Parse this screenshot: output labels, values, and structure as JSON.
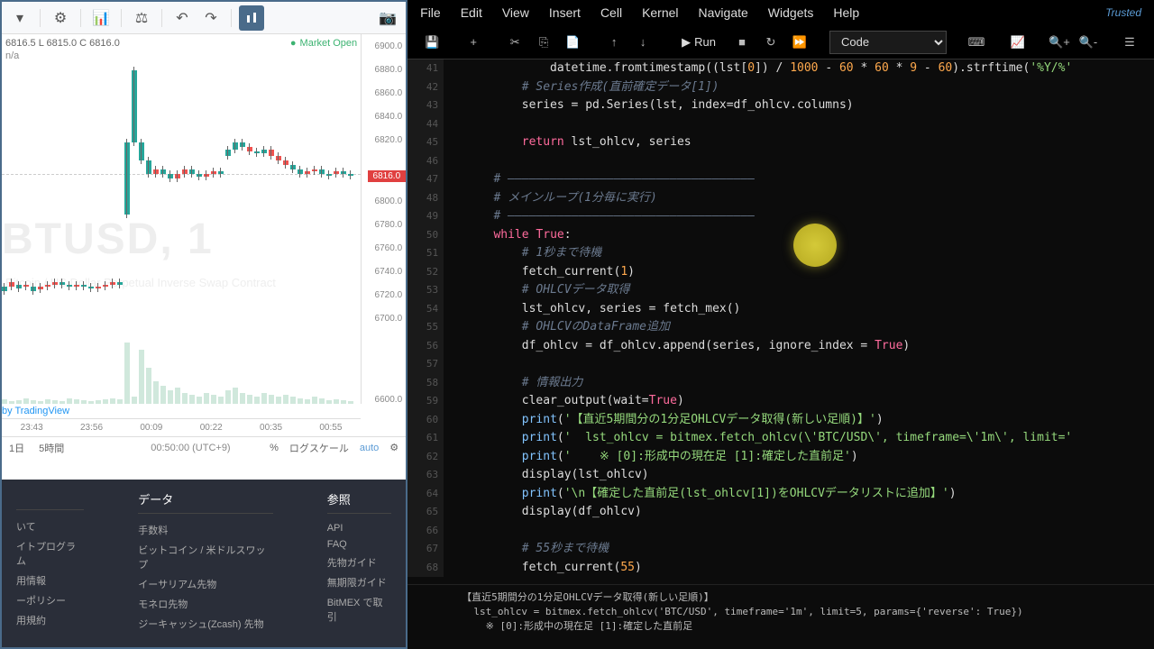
{
  "chart": {
    "ohlc": "6816.5 L 6815.0 C 6816.0",
    "na": "n/a",
    "market_status": "Market Open",
    "watermark": "BTUSD, 1",
    "watermark_sub": "Bitcoin / US Dollar Perpetual Inverse Swap Contract",
    "tv_link": "by TradingView",
    "price_current": "6816.0",
    "price_ticks": [
      "6900.0",
      "6880.0",
      "6860.0",
      "6840.0",
      "6820.0",
      "6800.0",
      "6780.0",
      "6760.0",
      "6740.0",
      "6720.0",
      "6700.0",
      "6600.0"
    ],
    "time_ticks": [
      "23:43",
      "23:56",
      "00:09",
      "00:22",
      "00:35",
      "00:55"
    ],
    "bottom": {
      "d1": "1日",
      "d5": "5時間",
      "time": "00:50:00 (UTC+9)",
      "pct": "%",
      "log": "ログスケール",
      "auto": "auto"
    }
  },
  "jupyter": {
    "menu": [
      "File",
      "Edit",
      "View",
      "Insert",
      "Cell",
      "Kernel",
      "Navigate",
      "Widgets",
      "Help"
    ],
    "trusted": "Trusted",
    "run": "Run",
    "cell_type": "Code",
    "line_start": 41,
    "code_lines": [
      {
        "n": 41,
        "html": "            datetime.fromtimestamp((lst[<span class='num'>0</span>]) / <span class='num'>1000</span> <span class='op'>-</span> <span class='num'>60</span> <span class='op'>*</span> <span class='num'>60</span> <span class='op'>*</span> <span class='num'>9</span> <span class='op'>-</span> <span class='num'>60</span>).strftime(<span class='str'>'%Y/%'</span>"
      },
      {
        "n": 42,
        "html": "        <span class='cm'># Series作成(直前確定データ[1])</span>"
      },
      {
        "n": 43,
        "html": "        series = pd.Series(lst, index=df_ohlcv.columns)"
      },
      {
        "n": 44,
        "html": ""
      },
      {
        "n": 45,
        "html": "        <span class='kw'>return</span> lst_ohlcv, series"
      },
      {
        "n": 46,
        "html": ""
      },
      {
        "n": 47,
        "html": "    <span class='cm'># ―――――――――――――――――――――――――――――――――――</span>"
      },
      {
        "n": 48,
        "html": "    <span class='cm'># メインループ(1分毎に実行)</span>"
      },
      {
        "n": 49,
        "html": "    <span class='cm'># ―――――――――――――――――――――――――――――――――――</span>"
      },
      {
        "n": 50,
        "html": "    <span class='kw'>while</span> <span class='bool'>True</span>:"
      },
      {
        "n": 51,
        "html": "        <span class='cm'># 1秒まで待機</span>"
      },
      {
        "n": 52,
        "html": "        fetch_current(<span class='num'>1</span>)"
      },
      {
        "n": 53,
        "html": "        <span class='cm'># OHLCVデータ取得</span>"
      },
      {
        "n": 54,
        "html": "        lst_ohlcv, series = fetch_mex()"
      },
      {
        "n": 55,
        "html": "        <span class='cm'># OHLCVのDataFrame追加</span>"
      },
      {
        "n": 56,
        "html": "        df_ohlcv = df_ohlcv.append(series, ignore_index = <span class='bool'>True</span>)"
      },
      {
        "n": 57,
        "html": ""
      },
      {
        "n": 58,
        "html": "        <span class='cm'># 情報出力</span>"
      },
      {
        "n": 59,
        "html": "        clear_output(wait=<span class='bool'>True</span>)"
      },
      {
        "n": 60,
        "html": "        <span class='fn'>print</span>(<span class='str'>'【直近5期間分の1分足OHLCVデータ取得(新しい足順)】'</span>)"
      },
      {
        "n": 61,
        "html": "        <span class='fn'>print</span>(<span class='str'>'  lst_ohlcv = bitmex.fetch_ohlcv(\\'BTC/USD\\', timeframe=\\'1m\\', limit='</span>"
      },
      {
        "n": 62,
        "html": "        <span class='fn'>print</span>(<span class='str'>'    ※ [0]:形成中の現在足 [1]:確定した直前足'</span>)"
      },
      {
        "n": 63,
        "html": "        display(lst_ohlcv)"
      },
      {
        "n": 64,
        "html": "        <span class='fn'>print</span>(<span class='str'>'\\n【確定した直前足(lst_ohlcv[1])をOHLCVデータリストに追加】'</span>)"
      },
      {
        "n": 65,
        "html": "        display(df_ohlcv)"
      },
      {
        "n": 66,
        "html": ""
      },
      {
        "n": 67,
        "html": "        <span class='cm'># 55秒まで待機</span>"
      },
      {
        "n": 68,
        "html": "        fetch_current(<span class='num'>55</span>)"
      }
    ],
    "output": "【直近5期間分の1分足OHLCVデータ取得(新しい足順)】\n  lst_ohlcv = bitmex.fetch_ohlcv('BTC/USD', timeframe='1m', limit=5, params={'reverse': True})\n    ※ [0]:形成中の現在足 [1]:確定した直前足"
  },
  "footer": {
    "col1": {
      "items": [
        "いて",
        "イトプログラム",
        "用情報",
        "ーポリシー",
        "用規約"
      ]
    },
    "col2": {
      "title": "データ",
      "items": [
        "手数料",
        "ビットコイン / 米ドルスワップ",
        "イーサリアム先物",
        "モネロ先物",
        "ジーキャッシュ(Zcash) 先物"
      ]
    },
    "col3": {
      "title": "参照",
      "items": [
        "API",
        "FAQ",
        "先物ガイド",
        "無期限ガイド",
        "BitMEX で取引"
      ]
    }
  }
}
